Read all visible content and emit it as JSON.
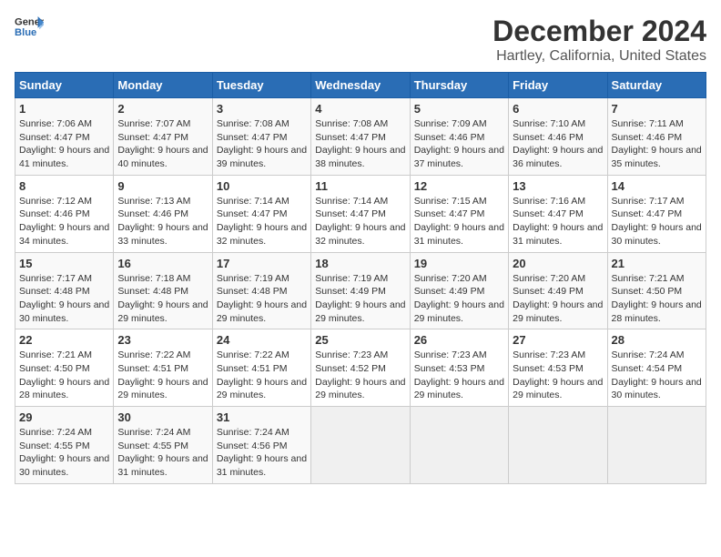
{
  "header": {
    "logo_general": "General",
    "logo_blue": "Blue",
    "title": "December 2024",
    "subtitle": "Hartley, California, United States"
  },
  "calendar": {
    "weekdays": [
      "Sunday",
      "Monday",
      "Tuesday",
      "Wednesday",
      "Thursday",
      "Friday",
      "Saturday"
    ],
    "weeks": [
      [
        {
          "day": "1",
          "sunrise": "7:06 AM",
          "sunset": "4:47 PM",
          "daylight": "9 hours and 41 minutes."
        },
        {
          "day": "2",
          "sunrise": "7:07 AM",
          "sunset": "4:47 PM",
          "daylight": "9 hours and 40 minutes."
        },
        {
          "day": "3",
          "sunrise": "7:08 AM",
          "sunset": "4:47 PM",
          "daylight": "9 hours and 39 minutes."
        },
        {
          "day": "4",
          "sunrise": "7:08 AM",
          "sunset": "4:47 PM",
          "daylight": "9 hours and 38 minutes."
        },
        {
          "day": "5",
          "sunrise": "7:09 AM",
          "sunset": "4:46 PM",
          "daylight": "9 hours and 37 minutes."
        },
        {
          "day": "6",
          "sunrise": "7:10 AM",
          "sunset": "4:46 PM",
          "daylight": "9 hours and 36 minutes."
        },
        {
          "day": "7",
          "sunrise": "7:11 AM",
          "sunset": "4:46 PM",
          "daylight": "9 hours and 35 minutes."
        }
      ],
      [
        {
          "day": "8",
          "sunrise": "7:12 AM",
          "sunset": "4:46 PM",
          "daylight": "9 hours and 34 minutes."
        },
        {
          "day": "9",
          "sunrise": "7:13 AM",
          "sunset": "4:46 PM",
          "daylight": "9 hours and 33 minutes."
        },
        {
          "day": "10",
          "sunrise": "7:14 AM",
          "sunset": "4:47 PM",
          "daylight": "9 hours and 32 minutes."
        },
        {
          "day": "11",
          "sunrise": "7:14 AM",
          "sunset": "4:47 PM",
          "daylight": "9 hours and 32 minutes."
        },
        {
          "day": "12",
          "sunrise": "7:15 AM",
          "sunset": "4:47 PM",
          "daylight": "9 hours and 31 minutes."
        },
        {
          "day": "13",
          "sunrise": "7:16 AM",
          "sunset": "4:47 PM",
          "daylight": "9 hours and 31 minutes."
        },
        {
          "day": "14",
          "sunrise": "7:17 AM",
          "sunset": "4:47 PM",
          "daylight": "9 hours and 30 minutes."
        }
      ],
      [
        {
          "day": "15",
          "sunrise": "7:17 AM",
          "sunset": "4:48 PM",
          "daylight": "9 hours and 30 minutes."
        },
        {
          "day": "16",
          "sunrise": "7:18 AM",
          "sunset": "4:48 PM",
          "daylight": "9 hours and 29 minutes."
        },
        {
          "day": "17",
          "sunrise": "7:19 AM",
          "sunset": "4:48 PM",
          "daylight": "9 hours and 29 minutes."
        },
        {
          "day": "18",
          "sunrise": "7:19 AM",
          "sunset": "4:49 PM",
          "daylight": "9 hours and 29 minutes."
        },
        {
          "day": "19",
          "sunrise": "7:20 AM",
          "sunset": "4:49 PM",
          "daylight": "9 hours and 29 minutes."
        },
        {
          "day": "20",
          "sunrise": "7:20 AM",
          "sunset": "4:49 PM",
          "daylight": "9 hours and 29 minutes."
        },
        {
          "day": "21",
          "sunrise": "7:21 AM",
          "sunset": "4:50 PM",
          "daylight": "9 hours and 28 minutes."
        }
      ],
      [
        {
          "day": "22",
          "sunrise": "7:21 AM",
          "sunset": "4:50 PM",
          "daylight": "9 hours and 28 minutes."
        },
        {
          "day": "23",
          "sunrise": "7:22 AM",
          "sunset": "4:51 PM",
          "daylight": "9 hours and 29 minutes."
        },
        {
          "day": "24",
          "sunrise": "7:22 AM",
          "sunset": "4:51 PM",
          "daylight": "9 hours and 29 minutes."
        },
        {
          "day": "25",
          "sunrise": "7:23 AM",
          "sunset": "4:52 PM",
          "daylight": "9 hours and 29 minutes."
        },
        {
          "day": "26",
          "sunrise": "7:23 AM",
          "sunset": "4:53 PM",
          "daylight": "9 hours and 29 minutes."
        },
        {
          "day": "27",
          "sunrise": "7:23 AM",
          "sunset": "4:53 PM",
          "daylight": "9 hours and 29 minutes."
        },
        {
          "day": "28",
          "sunrise": "7:24 AM",
          "sunset": "4:54 PM",
          "daylight": "9 hours and 30 minutes."
        }
      ],
      [
        {
          "day": "29",
          "sunrise": "7:24 AM",
          "sunset": "4:55 PM",
          "daylight": "9 hours and 30 minutes."
        },
        {
          "day": "30",
          "sunrise": "7:24 AM",
          "sunset": "4:55 PM",
          "daylight": "9 hours and 31 minutes."
        },
        {
          "day": "31",
          "sunrise": "7:24 AM",
          "sunset": "4:56 PM",
          "daylight": "9 hours and 31 minutes."
        },
        null,
        null,
        null,
        null
      ]
    ]
  }
}
